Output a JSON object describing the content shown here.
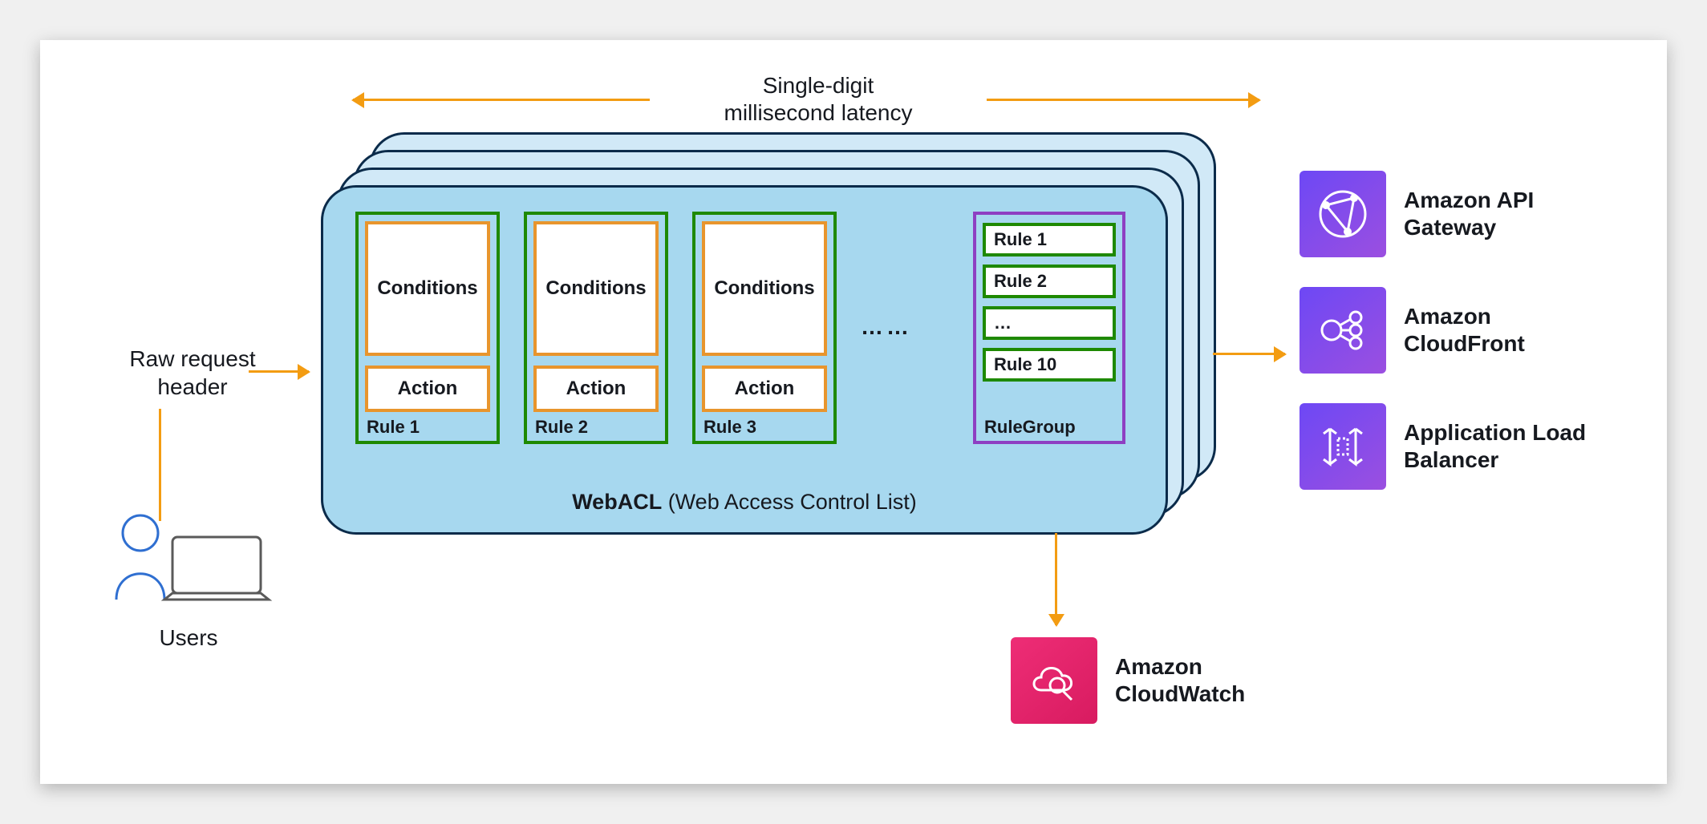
{
  "top": {
    "latency_line1": "Single-digit",
    "latency_line2": "millisecond latency"
  },
  "left": {
    "raw_line1": "Raw request",
    "raw_line2": "header",
    "users_label": "Users"
  },
  "webacl": {
    "title_bold": "WebACL",
    "title_rest": " (Web Access Control List)",
    "ellipsis": "……",
    "rules": [
      {
        "conditions": "Conditions",
        "action": "Action",
        "label": "Rule 1"
      },
      {
        "conditions": "Conditions",
        "action": "Action",
        "label": "Rule 2"
      },
      {
        "conditions": "Conditions",
        "action": "Action",
        "label": "Rule 3"
      }
    ],
    "rulegroup": {
      "label": "RuleGroup",
      "items": [
        "Rule 1",
        "Rule 2",
        "…",
        "Rule 10"
      ]
    }
  },
  "services": {
    "api": "Amazon API Gateway",
    "cf": "Amazon CloudFront",
    "alb": "Application Load Balancer",
    "cw": "Amazon CloudWatch"
  },
  "colors": {
    "arrow": "#f39c12",
    "card_border": "#0b2b4a",
    "card_fill_back": "#d1e9f7",
    "card_fill_front": "#a7d8ef",
    "rule_border": "#1e8900",
    "inner_border": "#e8952d",
    "rulegroup_border": "#8e3fc2",
    "purple_a": "#6d48f5",
    "purple_b": "#9b4fe0",
    "pink_a": "#ee2d76",
    "pink_b": "#d81b60"
  }
}
